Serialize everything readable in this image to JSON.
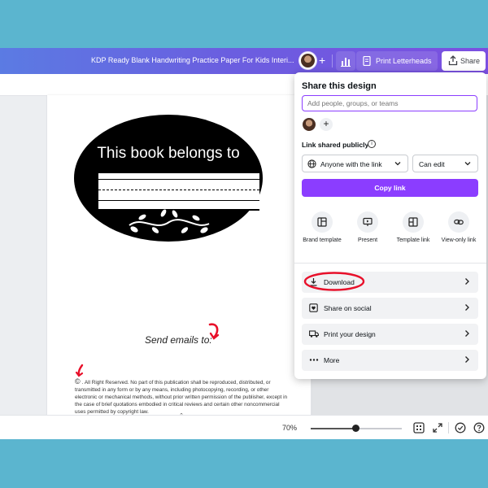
{
  "header": {
    "doc_title": "KDP Ready Blank Handwriting Practice Paper For Kids Interi...",
    "plus": "+",
    "print_label": "Print Letterheads",
    "share_label": "Share"
  },
  "page": {
    "title": "This book belongs to",
    "send_emails": "Send emails to:",
    "copyright_symbol": "©",
    "rights_text": ". All Right Reserved. No part of this publication shall be reproduced, distributed, or transmitted in any form or by any means, including photocopying, recording, or other electronic or mechanical methods, without prior written permission of the publisher, except in the case of brief quotations embodied in critical reviews and certain other noncommercial uses permitted by copyright law."
  },
  "bottom": {
    "zoom_label": "70%",
    "zoom_level": 0.49,
    "page_count_icon": "grid-view-icon",
    "collapse_glyph": "⌃"
  },
  "share_panel": {
    "title": "Share this design",
    "people_placeholder": "Add people, groups, or teams",
    "add_plus": "+",
    "link_label": "Link shared publicly",
    "info_glyph": "i",
    "access_value": "Anyone with the link",
    "permission_value": "Can edit",
    "copy_link": "Copy link",
    "options": [
      {
        "label": "Brand template",
        "icon": "brand-template-icon"
      },
      {
        "label": "Present",
        "icon": "present-icon"
      },
      {
        "label": "Template link",
        "icon": "template-link-icon"
      },
      {
        "label": "View-only link",
        "icon": "view-only-link-icon"
      }
    ],
    "rows": [
      {
        "label": "Download",
        "icon": "download-icon"
      },
      {
        "label": "Share on social",
        "icon": "heart-icon"
      },
      {
        "label": "Print your design",
        "icon": "truck-icon"
      },
      {
        "label": "More",
        "icon": "more-dots-icon"
      }
    ]
  },
  "colors": {
    "accent_purple": "#8b3dff",
    "background_teal": "#5bb5cf",
    "annotation_red": "#e8102a"
  }
}
